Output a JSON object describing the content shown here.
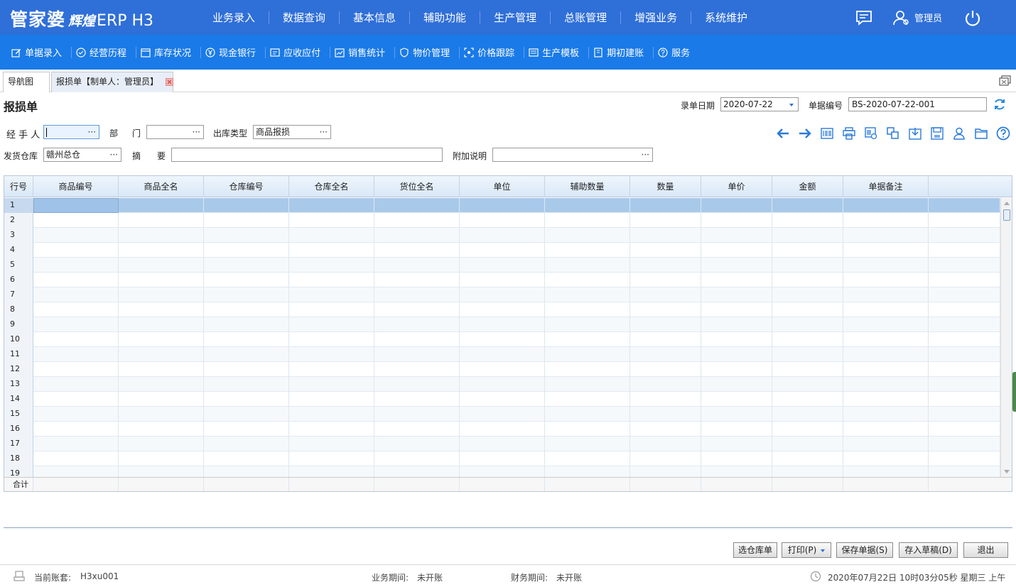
{
  "app": {
    "logo_main": "管家婆",
    "logo_sub": "辉煌",
    "logo_product": "ERP H3",
    "user_label": "管理员"
  },
  "topnav": [
    "业务录入",
    "数据查询",
    "基本信息",
    "辅助功能",
    "生产管理",
    "总账管理",
    "增强业务",
    "系统维护"
  ],
  "subnav": [
    {
      "label": "单据录入",
      "icon": "edit-icon"
    },
    {
      "label": "经营历程",
      "icon": "check-circle-icon"
    },
    {
      "label": "库存状况",
      "icon": "calendar-icon"
    },
    {
      "label": "现金银行",
      "icon": "yen-circle-icon"
    },
    {
      "label": "应收应付",
      "icon": "receivable-icon"
    },
    {
      "label": "销售统计",
      "icon": "sales-icon"
    },
    {
      "label": "物价管理",
      "icon": "shield-icon"
    },
    {
      "label": "价格跟踪",
      "icon": "price-track-icon"
    },
    {
      "label": "生产模板",
      "icon": "template-icon"
    },
    {
      "label": "期初建账",
      "icon": "ledger-icon"
    },
    {
      "label": "服务",
      "icon": "help-circle-icon"
    }
  ],
  "tabs": {
    "nav": "导航图",
    "active": "报损单【制单人：管理员】"
  },
  "form": {
    "title": "报损单",
    "date_label": "录单日期",
    "date_value": "2020-07-22",
    "number_label": "单据编号",
    "number_value": "BS-2020-07-22-001",
    "handler_label": "经 手 人",
    "handler_value": "",
    "dept_label_1": "部",
    "dept_label_2": "门",
    "dept_value": "",
    "outtype_label": "出库类型",
    "outtype_value": "商品报损",
    "warehouse_label": "发货仓库",
    "warehouse_value": "赣州总仓",
    "summary_label_1": "摘",
    "summary_label_2": "要",
    "summary_value": "",
    "note_label": "附加说明",
    "note_value": ""
  },
  "grid": {
    "columns": [
      "行号",
      "商品编号",
      "商品全名",
      "仓库编号",
      "仓库全名",
      "货位全名",
      "单位",
      "辅助数量",
      "数量",
      "单价",
      "金额",
      "单据备注"
    ],
    "rows": [
      "1",
      "2",
      "3",
      "4",
      "5",
      "6",
      "7",
      "8",
      "9",
      "10",
      "11",
      "12",
      "13",
      "14",
      "15",
      "16",
      "17",
      "18",
      "19"
    ],
    "total_label": "合计"
  },
  "buttons": {
    "select_order": "选仓库单",
    "print": "打印(P)",
    "save": "保存单据(S)",
    "draft": "存入草稿(D)",
    "exit": "退出"
  },
  "status": {
    "account_label": "当前账套:",
    "account_value": "H3xu001",
    "biz_period_label": "业务期间:",
    "biz_period_value": "未开账",
    "fin_period_label": "财务期间:",
    "fin_period_value": "未开账",
    "datetime": "2020年07月22日 10时03分05秒 星期三 上午"
  },
  "colors": {
    "topbar": "#2f6fd8",
    "subbar": "#1a7ae8",
    "selected_row": "#a9c9ea"
  }
}
